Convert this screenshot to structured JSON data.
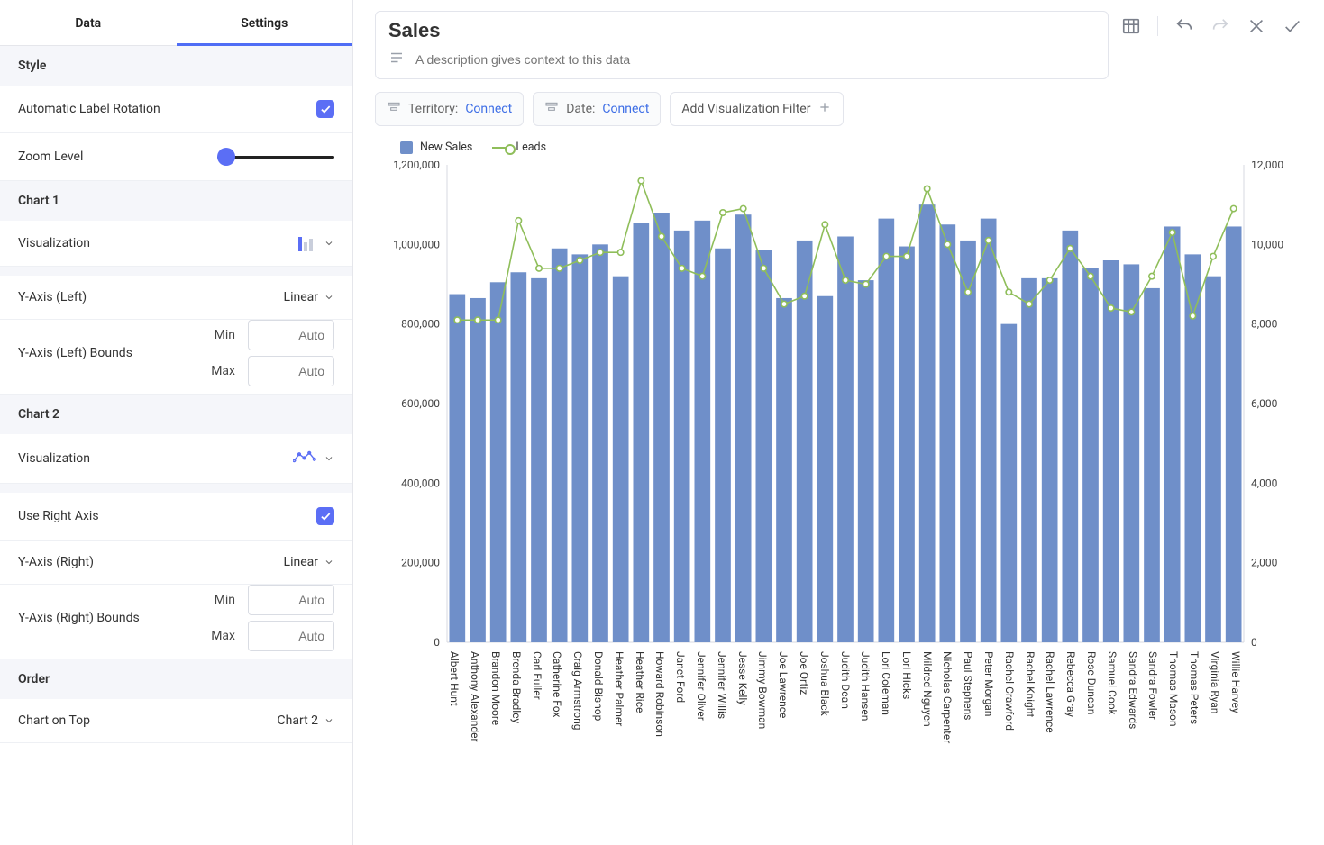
{
  "tabs": {
    "data": "Data",
    "settings": "Settings",
    "active": "settings"
  },
  "sidebar": {
    "style_header": "Style",
    "auto_label_rotation": "Automatic Label Rotation",
    "zoom_level": "Zoom Level",
    "chart1_header": "Chart 1",
    "chart2_header": "Chart 2",
    "visualization": "Visualization",
    "y_left": "Y-Axis (Left)",
    "y_left_scale": "Linear",
    "y_left_bounds": "Y-Axis (Left) Bounds",
    "use_right_axis": "Use Right Axis",
    "y_right": "Y-Axis (Right)",
    "y_right_scale": "Linear",
    "y_right_bounds": "Y-Axis (Right) Bounds",
    "min": "Min",
    "max": "Max",
    "auto": "Auto",
    "order_header": "Order",
    "chart_on_top": "Chart on Top",
    "chart_on_top_value": "Chart 2"
  },
  "header": {
    "title": "Sales",
    "description_placeholder": "A description gives context to this data"
  },
  "filters": {
    "territory_key": "Territory:",
    "territory_value": "Connect",
    "date_key": "Date:",
    "date_value": "Connect",
    "add_label": "Add Visualization Filter"
  },
  "legend": {
    "bars": "New Sales",
    "line": "Leads"
  },
  "chart_data": {
    "type": "bar+line",
    "ylabel_left": "",
    "ylabel_right": "",
    "ylim_left": [
      0,
      1200000
    ],
    "ylim_right": [
      0,
      12000
    ],
    "y_ticks_left": [
      "0",
      "200,000",
      "400,000",
      "600,000",
      "800,000",
      "1,000,000",
      "1,200,000"
    ],
    "y_ticks_right": [
      "0",
      "2,000",
      "4,000",
      "6,000",
      "8,000",
      "10,000",
      "12,000"
    ],
    "categories": [
      "Albert Hunt",
      "Anthony Alexander",
      "Brandon Moore",
      "Brenda Bradley",
      "Carl Fuller",
      "Catherine Fox",
      "Craig Armstrong",
      "Donald Bishop",
      "Heather Palmer",
      "Heather Rice",
      "Howard Robinson",
      "Janet Ford",
      "Jennifer Oliver",
      "Jennifer Willis",
      "Jesse Kelly",
      "Jimmy Bowman",
      "Joe Lawrence",
      "Joe Ortiz",
      "Joshua Black",
      "Judith Dean",
      "Judith Hansen",
      "Lori Coleman",
      "Lori Hicks",
      "Mildred Nguyen",
      "Nicholas Carpenter",
      "Paul Stephens",
      "Peter Morgan",
      "Rachel Crawford",
      "Rachel Knight",
      "Rachel Lawrence",
      "Rebecca Gray",
      "Rose Duncan",
      "Samuel Cook",
      "Sandra Edwards",
      "Sandra Fowler",
      "Thomas Mason",
      "Thomas Peters",
      "Virginia Ryan",
      "Willie Harvey"
    ],
    "series": [
      {
        "name": "New Sales",
        "type": "bar",
        "axis": "left",
        "values": [
          875000,
          865000,
          905000,
          930000,
          915000,
          990000,
          975000,
          1000000,
          920000,
          1055000,
          1080000,
          1035000,
          1060000,
          990000,
          1075000,
          985000,
          865000,
          1010000,
          870000,
          1020000,
          910000,
          1065000,
          995000,
          1100000,
          1050000,
          1010000,
          1065000,
          800000,
          915000,
          915000,
          1035000,
          940000,
          960000,
          950000,
          890000,
          1045000,
          975000,
          920000,
          1045000
        ]
      },
      {
        "name": "Leads",
        "type": "line",
        "axis": "right",
        "values": [
          8100,
          8100,
          8100,
          10600,
          9400,
          9400,
          9600,
          9800,
          9800,
          11600,
          10200,
          9400,
          9200,
          10800,
          10900,
          9400,
          8500,
          8700,
          10500,
          9100,
          9000,
          9700,
          9700,
          11400,
          10000,
          8800,
          10100,
          8800,
          8500,
          9100,
          9900,
          9200,
          8400,
          8300,
          9200,
          10300,
          8200,
          9700,
          10900
        ]
      }
    ]
  }
}
